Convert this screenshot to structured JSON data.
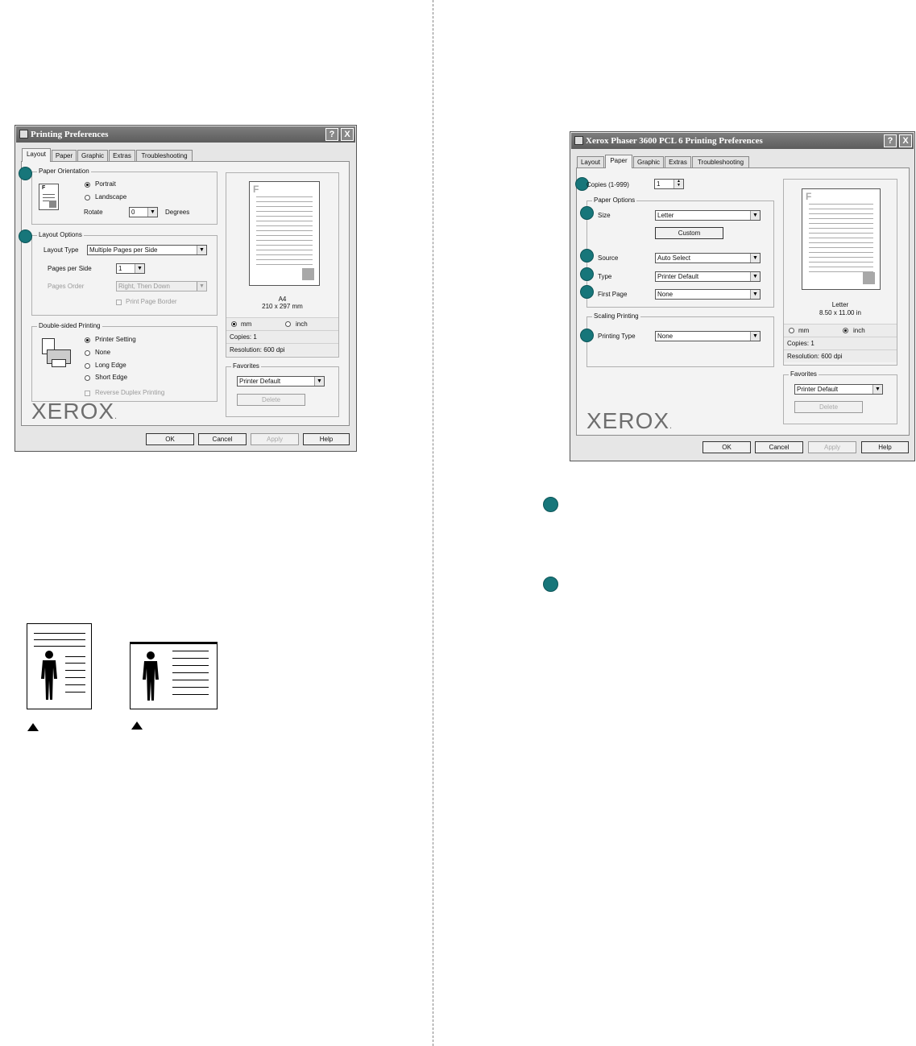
{
  "dialog1": {
    "title": "Printing Preferences",
    "help_btn": "?",
    "close_btn": "X",
    "tabs": [
      "Layout",
      "Paper",
      "Graphic",
      "Extras",
      "Troubleshooting"
    ],
    "orientation": {
      "group": "Paper Orientation",
      "portrait": "Portrait",
      "landscape": "Landscape",
      "rotate_label": "Rotate",
      "rotate_value": "0",
      "degrees": "Degrees"
    },
    "layout_options": {
      "group": "Layout Options",
      "type_label": "Layout Type",
      "type_value": "Multiple Pages per Side",
      "pps_label": "Pages per Side",
      "pps_value": "1",
      "order_label": "Pages Order",
      "order_value": "Right, Then Down",
      "border_label": "Print Page Border"
    },
    "duplex": {
      "group": "Double-sided Printing",
      "opt_printer": "Printer Setting",
      "opt_none": "None",
      "opt_long": "Long Edge",
      "opt_short": "Short Edge",
      "reverse": "Reverse Duplex Printing"
    },
    "preview": {
      "paper": "A4",
      "dims": "210 x 297 mm",
      "unit_mm": "mm",
      "unit_inch": "inch",
      "copies": "Copies: 1",
      "resolution": "Resolution: 600 dpi"
    },
    "favorites": {
      "group": "Favorites",
      "value": "Printer Default",
      "delete": "Delete"
    },
    "logo": "XEROX",
    "buttons": {
      "ok": "OK",
      "cancel": "Cancel",
      "apply": "Apply",
      "help": "Help"
    }
  },
  "dialog2": {
    "title": "Xerox Phaser 3600 PCL 6 Printing Preferences",
    "help_btn": "?",
    "close_btn": "X",
    "tabs": [
      "Layout",
      "Paper",
      "Graphic",
      "Extras",
      "Troubleshooting"
    ],
    "copies_label": "Copies (1-999)",
    "copies_value": "1",
    "paper_options": {
      "group": "Paper Options",
      "size_label": "Size",
      "size_value": "Letter",
      "custom": "Custom",
      "source_label": "Source",
      "source_value": "Auto Select",
      "type_label": "Type",
      "type_value": "Printer Default",
      "first_label": "First Page",
      "first_value": "None"
    },
    "scaling": {
      "group": "Scaling Printing",
      "label": "Printing Type",
      "value": "None"
    },
    "preview": {
      "paper": "Letter",
      "dims": "8.50 x 11.00 in",
      "unit_mm": "mm",
      "unit_inch": "inch",
      "copies": "Copies: 1",
      "resolution": "Resolution: 600 dpi"
    },
    "favorites": {
      "group": "Favorites",
      "value": "Printer Default",
      "delete": "Delete"
    },
    "logo": "XEROX",
    "buttons": {
      "ok": "OK",
      "cancel": "Cancel",
      "apply": "Apply",
      "help": "Help"
    }
  },
  "colors": {
    "badge": "#17767a",
    "titlebar": "#6b6b6b"
  },
  "icons": [
    "printer-icon",
    "document-icon",
    "duplex-printer-icon",
    "person-icon",
    "triangle-icon"
  ]
}
